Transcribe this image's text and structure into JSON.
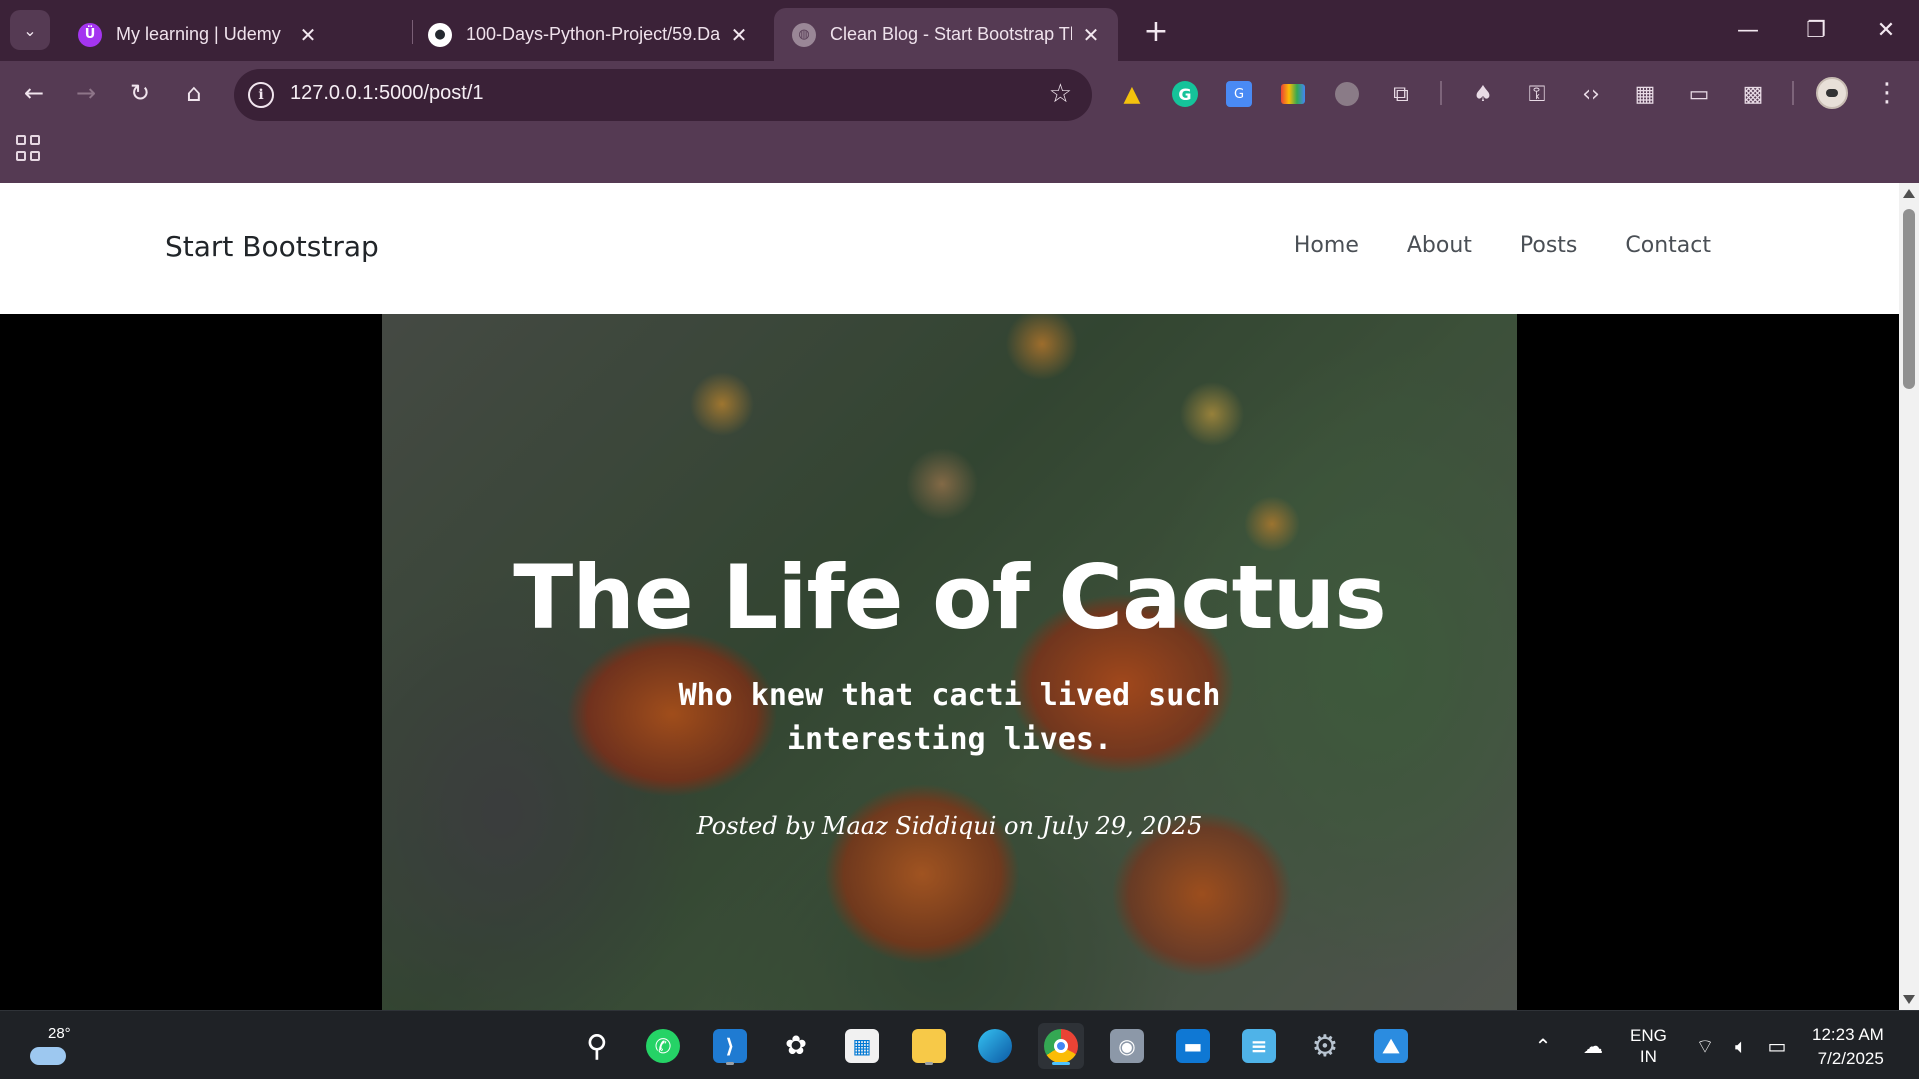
{
  "browser": {
    "tabs": [
      {
        "title": "My learning | Udemy",
        "icon": "udemy-icon",
        "favicon_glyph": "Ü",
        "color": "#a435f0"
      },
      {
        "title": "100-Days-Python-Project/59.Da",
        "icon": "github-icon",
        "favicon_glyph": "●",
        "color": "#ffffff"
      },
      {
        "title": "Clean Blog - Start Bootstrap The",
        "icon": "globe-icon",
        "favicon_glyph": "◍",
        "color": "#9a8797",
        "active": true
      }
    ],
    "url": "127.0.0.1:5000/post/1"
  },
  "site": {
    "brand": "Start Bootstrap",
    "nav": [
      "Home",
      "About",
      "Posts",
      "Contact"
    ]
  },
  "post": {
    "title": "The Life of Cactus",
    "subtitle": "Who knew that cacti lived such interesting lives.",
    "meta": "Posted by Maaz Siddiqui on July 29, 2025"
  },
  "taskbar": {
    "weather_temp": "28°",
    "language_line1": "ENG",
    "language_line2": "IN",
    "time": "12:23 AM",
    "date": "7/2/2025"
  },
  "colors": {
    "chrome_dark": "#3b2238",
    "chrome_toolbar": "#553a53",
    "taskbar": "#1f2226"
  }
}
